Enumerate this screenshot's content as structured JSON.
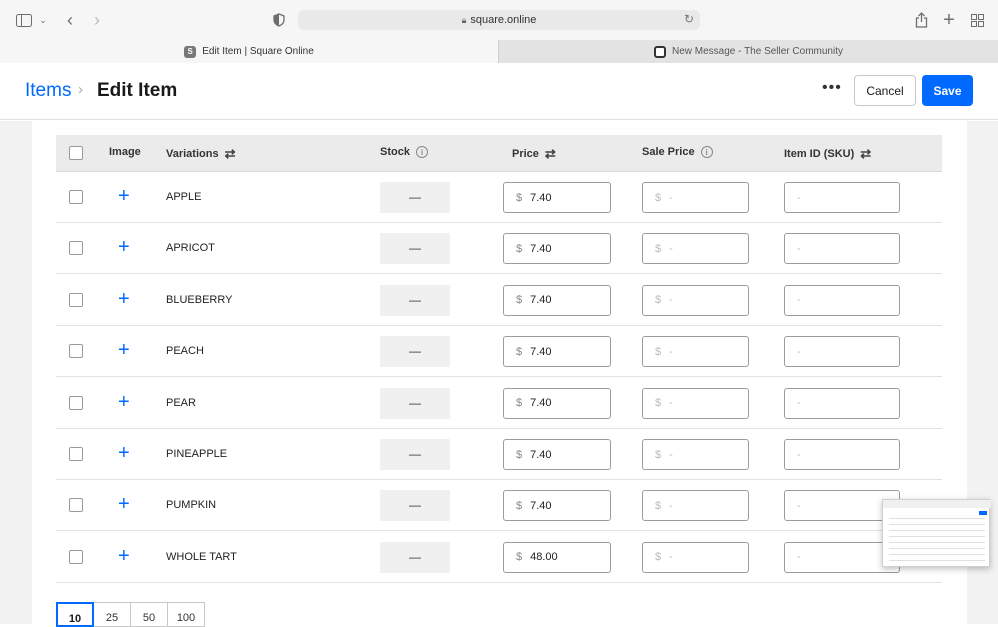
{
  "browser": {
    "url": "square.online",
    "tabs": [
      {
        "label": "Edit Item | Square Online",
        "favicon": "S"
      },
      {
        "label": "New Message - The Seller Community",
        "favicon": ""
      }
    ]
  },
  "header": {
    "breadcrumb_root": "Items",
    "breadcrumb_sep": "›",
    "title": "Edit Item",
    "more": "•••",
    "cancel_label": "Cancel",
    "save_label": "Save",
    "accent_color": "#006aff"
  },
  "table": {
    "columns": {
      "image": "Image",
      "variations": "Variations",
      "stock": "Stock",
      "price": "Price",
      "sale_price": "Sale Price",
      "sku": "Item ID (SKU)"
    },
    "currency": "$",
    "placeholder": "-",
    "stock_value": "—",
    "rows": [
      {
        "name": "APPLE",
        "price": "7.40"
      },
      {
        "name": "APRICOT",
        "price": "7.40"
      },
      {
        "name": "BLUEBERRY",
        "price": "7.40"
      },
      {
        "name": "PEACH",
        "price": "7.40"
      },
      {
        "name": "PEAR",
        "price": "7.40"
      },
      {
        "name": "PINEAPPLE",
        "price": "7.40"
      },
      {
        "name": "PUMPKIN",
        "price": "7.40"
      },
      {
        "name": "WHOLE TART",
        "price": "48.00"
      }
    ]
  },
  "pagination": {
    "options": [
      "10",
      "25",
      "50",
      "100"
    ],
    "selected": "10"
  }
}
